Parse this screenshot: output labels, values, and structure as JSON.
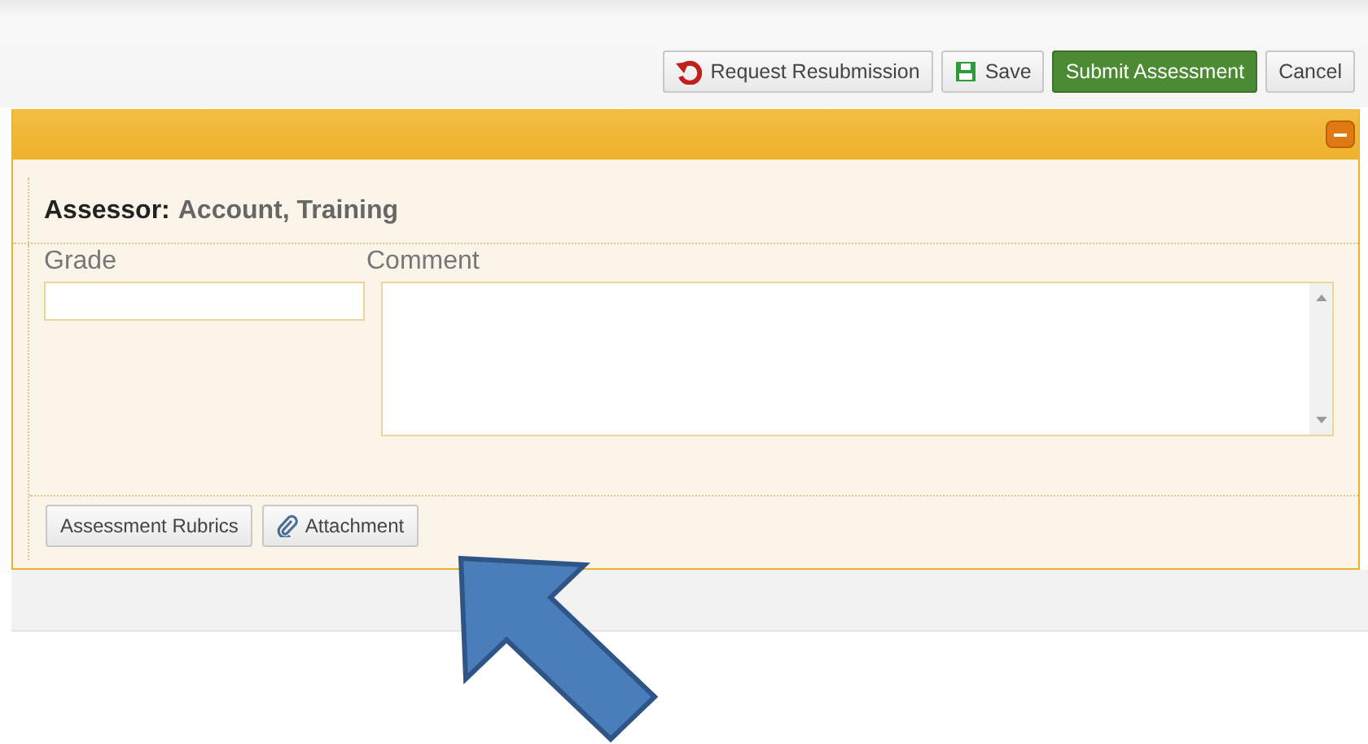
{
  "toolbar": {
    "buttons": [
      {
        "label": "Request Resubmission",
        "kind": "resubmit"
      },
      {
        "label": "Save",
        "kind": "save"
      },
      {
        "label": "Submit Assessment",
        "kind": "primary"
      },
      {
        "label": "Cancel",
        "kind": "plain"
      }
    ]
  },
  "panel": {
    "expanded": true,
    "assessor_label": "Assessor:",
    "assessor_name": "Account, Training",
    "grade_label": "Grade",
    "comment_label": "Comment",
    "buttons": [
      {
        "label": "Assessment Rubrics",
        "kind": "plain"
      },
      {
        "label": "Attachment",
        "kind": "attach"
      }
    ]
  }
}
